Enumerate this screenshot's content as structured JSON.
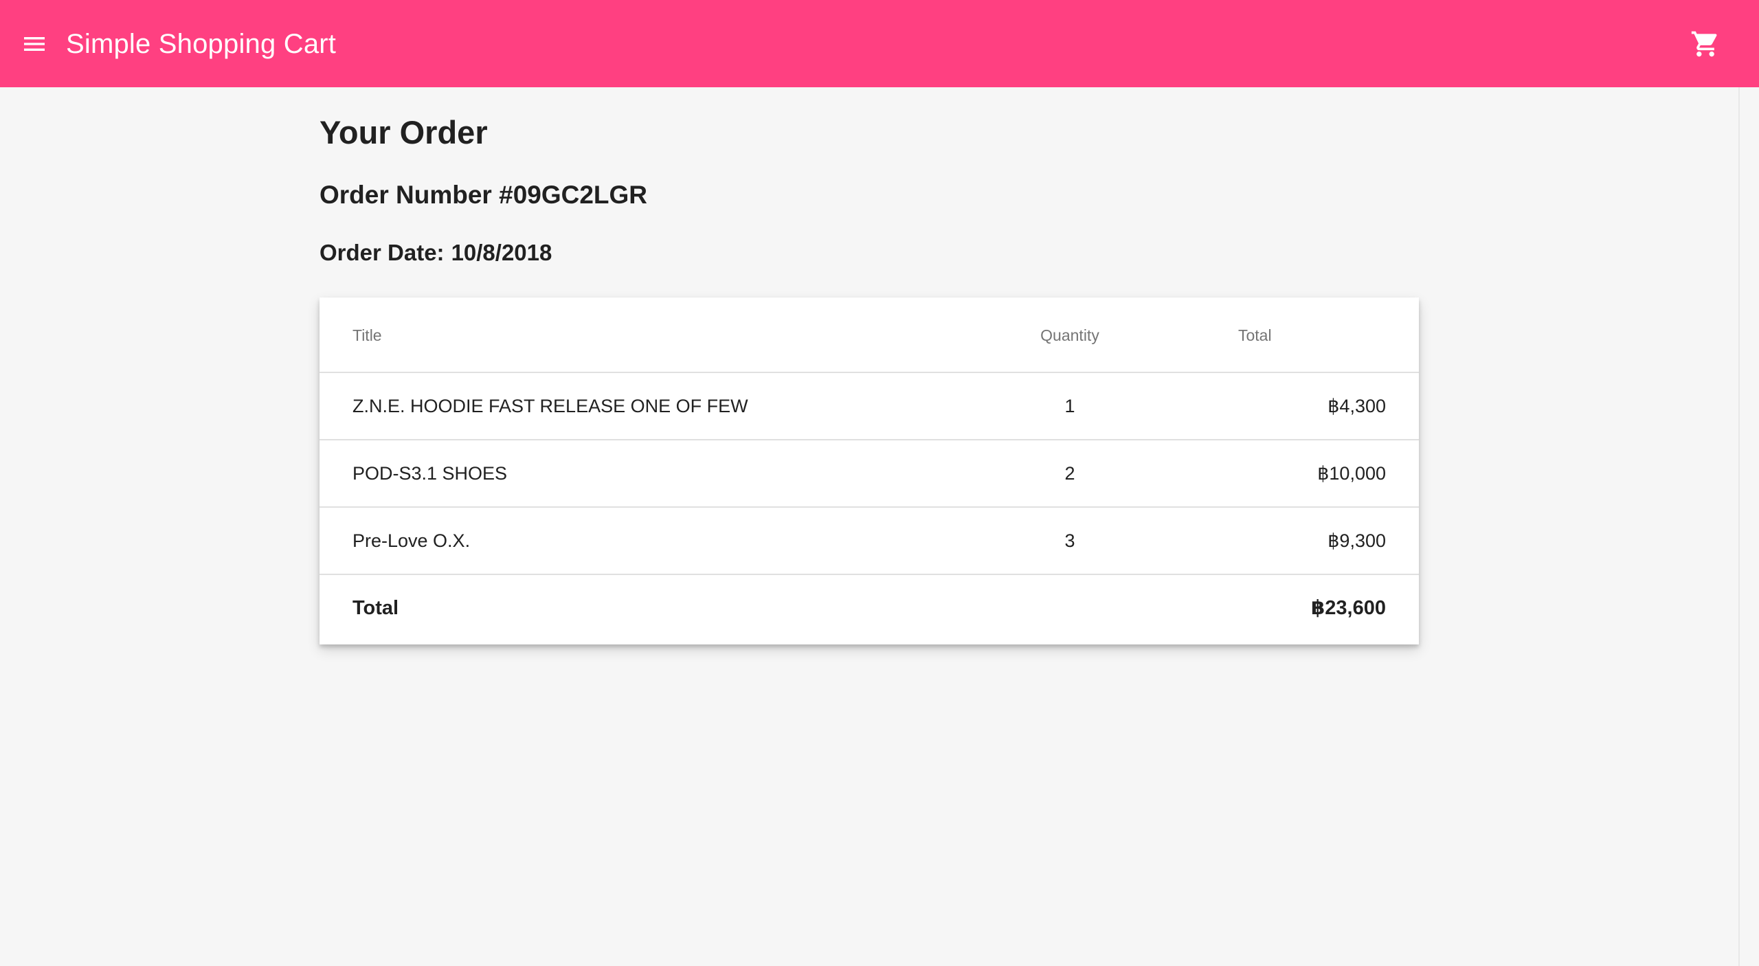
{
  "appbar": {
    "title": "Simple Shopping Cart",
    "background_color": "#ff4081",
    "menu_icon": "menu-icon",
    "cart_icon": "shopping-cart-icon"
  },
  "order": {
    "heading": "Your Order",
    "number_text": "Order Number #09GC2LGR",
    "date_label": "Order Date:",
    "date_value": "10/8/2018"
  },
  "table": {
    "headers": {
      "title": "Title",
      "quantity": "Quantity",
      "total": "Total"
    },
    "rows": [
      {
        "title": "Z.N.E. HOODIE FAST RELEASE ONE OF FEW",
        "quantity": "1",
        "total": "฿4,300"
      },
      {
        "title": "POD-S3.1 SHOES",
        "quantity": "2",
        "total": "฿10,000"
      },
      {
        "title": "Pre-Love O.X.",
        "quantity": "3",
        "total": "฿9,300"
      }
    ],
    "footer": {
      "label": "Total",
      "value": "฿23,600"
    }
  }
}
